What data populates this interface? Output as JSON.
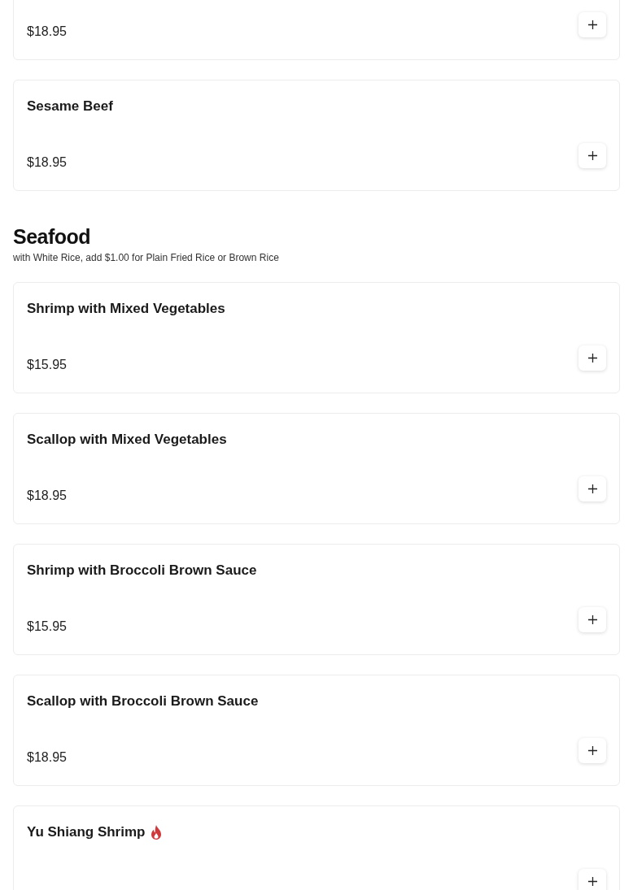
{
  "sections": [
    {
      "items": [
        {
          "price": "$18.95"
        },
        {
          "name": "Sesame Beef",
          "price": "$18.95",
          "spicy": false
        }
      ]
    },
    {
      "title": "Seafood",
      "subtitle": "with White Rice, add $1.00 for Plain Fried Rice or Brown Rice",
      "items": [
        {
          "name": "Shrimp with Mixed Vegetables",
          "price": "$15.95",
          "spicy": false
        },
        {
          "name": "Scallop with Mixed Vegetables",
          "price": "$18.95",
          "spicy": false
        },
        {
          "name": "Shrimp with Broccoli Brown Sauce",
          "price": "$15.95",
          "spicy": false
        },
        {
          "name": "Scallop with Broccoli Brown Sauce",
          "price": "$18.95",
          "spicy": false
        },
        {
          "name": "Yu Shiang Shrimp",
          "spicy": true
        }
      ]
    }
  ]
}
